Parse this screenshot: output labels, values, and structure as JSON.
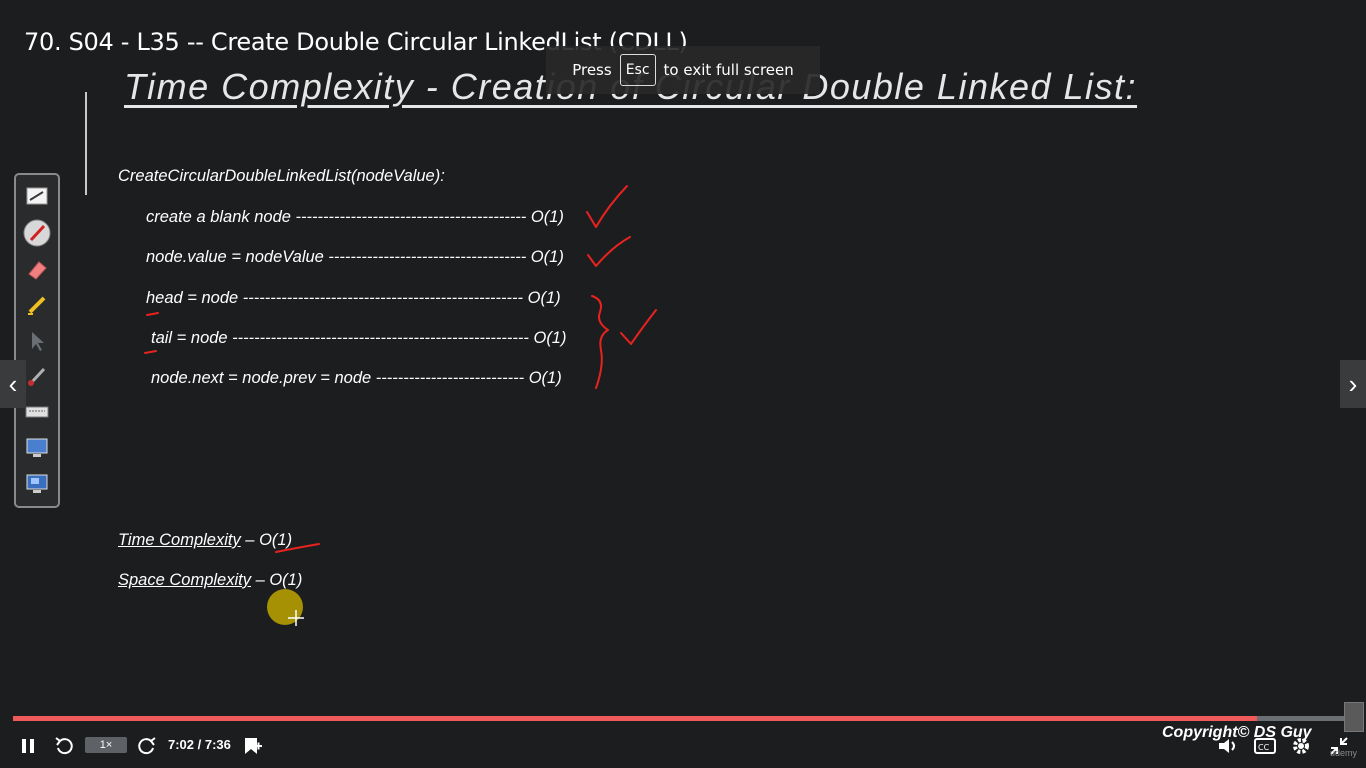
{
  "video_title": "70. S04 - L35 -- Create Double Circular LinkedList (CDLL)",
  "fullscreen_notice": {
    "press": "Press",
    "key": "Esc",
    "suffix": "to exit full screen"
  },
  "slide": {
    "title": "Time Complexity - Creation of Circular Double Linked List:",
    "function_signature": "CreateCircularDoubleLinkedList(nodeValue):",
    "lines": [
      {
        "text": "create a blank node ------------------------------------------ O(1)"
      },
      {
        "text": "node.value = nodeValue ------------------------------------ O(1)"
      },
      {
        "text": "head = node --------------------------------------------------- O(1)"
      },
      {
        "text": "tail = node ------------------------------------------------------ O(1)"
      },
      {
        "text": "node.next = node.prev = node --------------------------- O(1)"
      }
    ],
    "time_complexity_label": "Time Complexity",
    "time_complexity_value": " – O(1)",
    "space_complexity_label": "Space Complexity",
    "space_complexity_value": " – O(1)",
    "annotation_color": "#e8231f"
  },
  "toolbar": {
    "tools": [
      "notepad-icon",
      "pen-icon",
      "eraser-icon",
      "highlighter-icon",
      "pointer-icon",
      "brush-icon",
      "keyboard-icon",
      "screen-icon",
      "desktop-icon"
    ]
  },
  "player": {
    "progress_fraction": 0.928,
    "speed_label": "1×",
    "time_label": "7:02 / 7:36",
    "copyright": "Copyright© DS Guy",
    "watermark": "udemy",
    "progress_color": "#f05a5a"
  }
}
